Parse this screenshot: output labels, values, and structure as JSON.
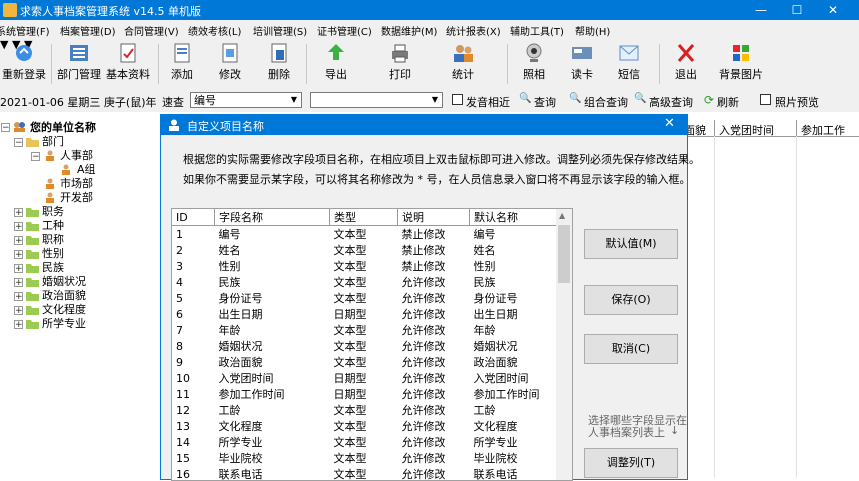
{
  "window": {
    "title": "求索人事档案管理系统 v14.5 单机版",
    "minimize": "—",
    "maximize": "☐",
    "close": "✕"
  },
  "menu": [
    "系统管理(F)",
    "档案管理(D)",
    "合同管理(V)",
    "绩效考核(L)",
    "培训管理(S)",
    "证书管理(C)",
    "数据维护(M)",
    "统计报表(X)",
    "辅助工具(T)",
    "帮助(H)"
  ],
  "toolbar": {
    "relogin": "重新登录",
    "dept": "部门管理",
    "basic": "基本资料",
    "add": "添加",
    "edit": "修改",
    "delete": "删除",
    "export": "导出",
    "print": "打印",
    "stats": "统计",
    "photo": "照相",
    "card": "读卡",
    "sms": "短信",
    "exit": "退出",
    "bg": "背景图片"
  },
  "searchbar": {
    "date": "2021-01-06 星期三 庚子(鼠)年",
    "fast_label": "速查",
    "field_value": "编号",
    "query_value": "",
    "similar": "发音相近",
    "query": "查询",
    "combo_query": "组合查询",
    "adv_query": "高级查询",
    "refresh": "刷新",
    "preview": "照片预览",
    "arrow_glyph": "▼",
    "magnifier_glyph": "🔍",
    "refresh_glyph": "⟳"
  },
  "tree": {
    "root": "您的单位名称",
    "dept": "部门",
    "hr": "人事部",
    "a_group": "A组",
    "market": "市场部",
    "dev": "开发部",
    "categories": [
      "职务",
      "工种",
      "职称",
      "性别",
      "民族",
      "婚姻状况",
      "政治面貌",
      "文化程度",
      "所学专业"
    ],
    "collapse_glyph": "−",
    "expand_glyph": "+"
  },
  "background_grid": {
    "headers": [
      "面貌",
      "入党团时间",
      "参加工作"
    ]
  },
  "dialog": {
    "title": "自定义项目名称",
    "close": "✕",
    "line1": "根据您的实际需要修改字段项目名称，在相应项目上双击鼠标即可进入修改。调整列必须先保存修改结果。",
    "line2": "如果你不需要显示某字段，可以将其名称修改为 * 号，在人员信息录入窗口将不再显示该字段的输入框。",
    "columns": [
      "ID",
      "字段名称",
      "类型",
      "说明",
      "默认名称"
    ],
    "rows": [
      [
        "1",
        "编号",
        "文本型",
        "禁止修改",
        "编号"
      ],
      [
        "2",
        "姓名",
        "文本型",
        "禁止修改",
        "姓名"
      ],
      [
        "3",
        "性别",
        "文本型",
        "禁止修改",
        "性别"
      ],
      [
        "4",
        "民族",
        "文本型",
        "允许修改",
        "民族"
      ],
      [
        "5",
        "身份证号",
        "文本型",
        "允许修改",
        "身份证号"
      ],
      [
        "6",
        "出生日期",
        "日期型",
        "允许修改",
        "出生日期"
      ],
      [
        "7",
        "年龄",
        "文本型",
        "允许修改",
        "年龄"
      ],
      [
        "8",
        "婚姻状况",
        "文本型",
        "允许修改",
        "婚姻状况"
      ],
      [
        "9",
        "政治面貌",
        "文本型",
        "允许修改",
        "政治面貌"
      ],
      [
        "10",
        "入党团时间",
        "日期型",
        "允许修改",
        "入党团时间"
      ],
      [
        "11",
        "参加工作时间",
        "日期型",
        "允许修改",
        "参加工作时间"
      ],
      [
        "12",
        "工龄",
        "文本型",
        "允许修改",
        "工龄"
      ],
      [
        "13",
        "文化程度",
        "文本型",
        "允许修改",
        "文化程度"
      ],
      [
        "14",
        "所学专业",
        "文本型",
        "允许修改",
        "所学专业"
      ],
      [
        "15",
        "毕业院校",
        "文本型",
        "允许修改",
        "毕业院校"
      ],
      [
        "16",
        "联系电话",
        "文本型",
        "允许修改",
        "联系电话"
      ]
    ],
    "buttons": {
      "default": "默认值(M)",
      "save": "保存(O)",
      "cancel": "取消(C)",
      "adjust": "调整列(T)"
    },
    "hint_line1": "选择哪些字段显示在",
    "hint_line2": "人事档案列表上",
    "hint_arrow": "↓",
    "scroll_up": "▲"
  }
}
